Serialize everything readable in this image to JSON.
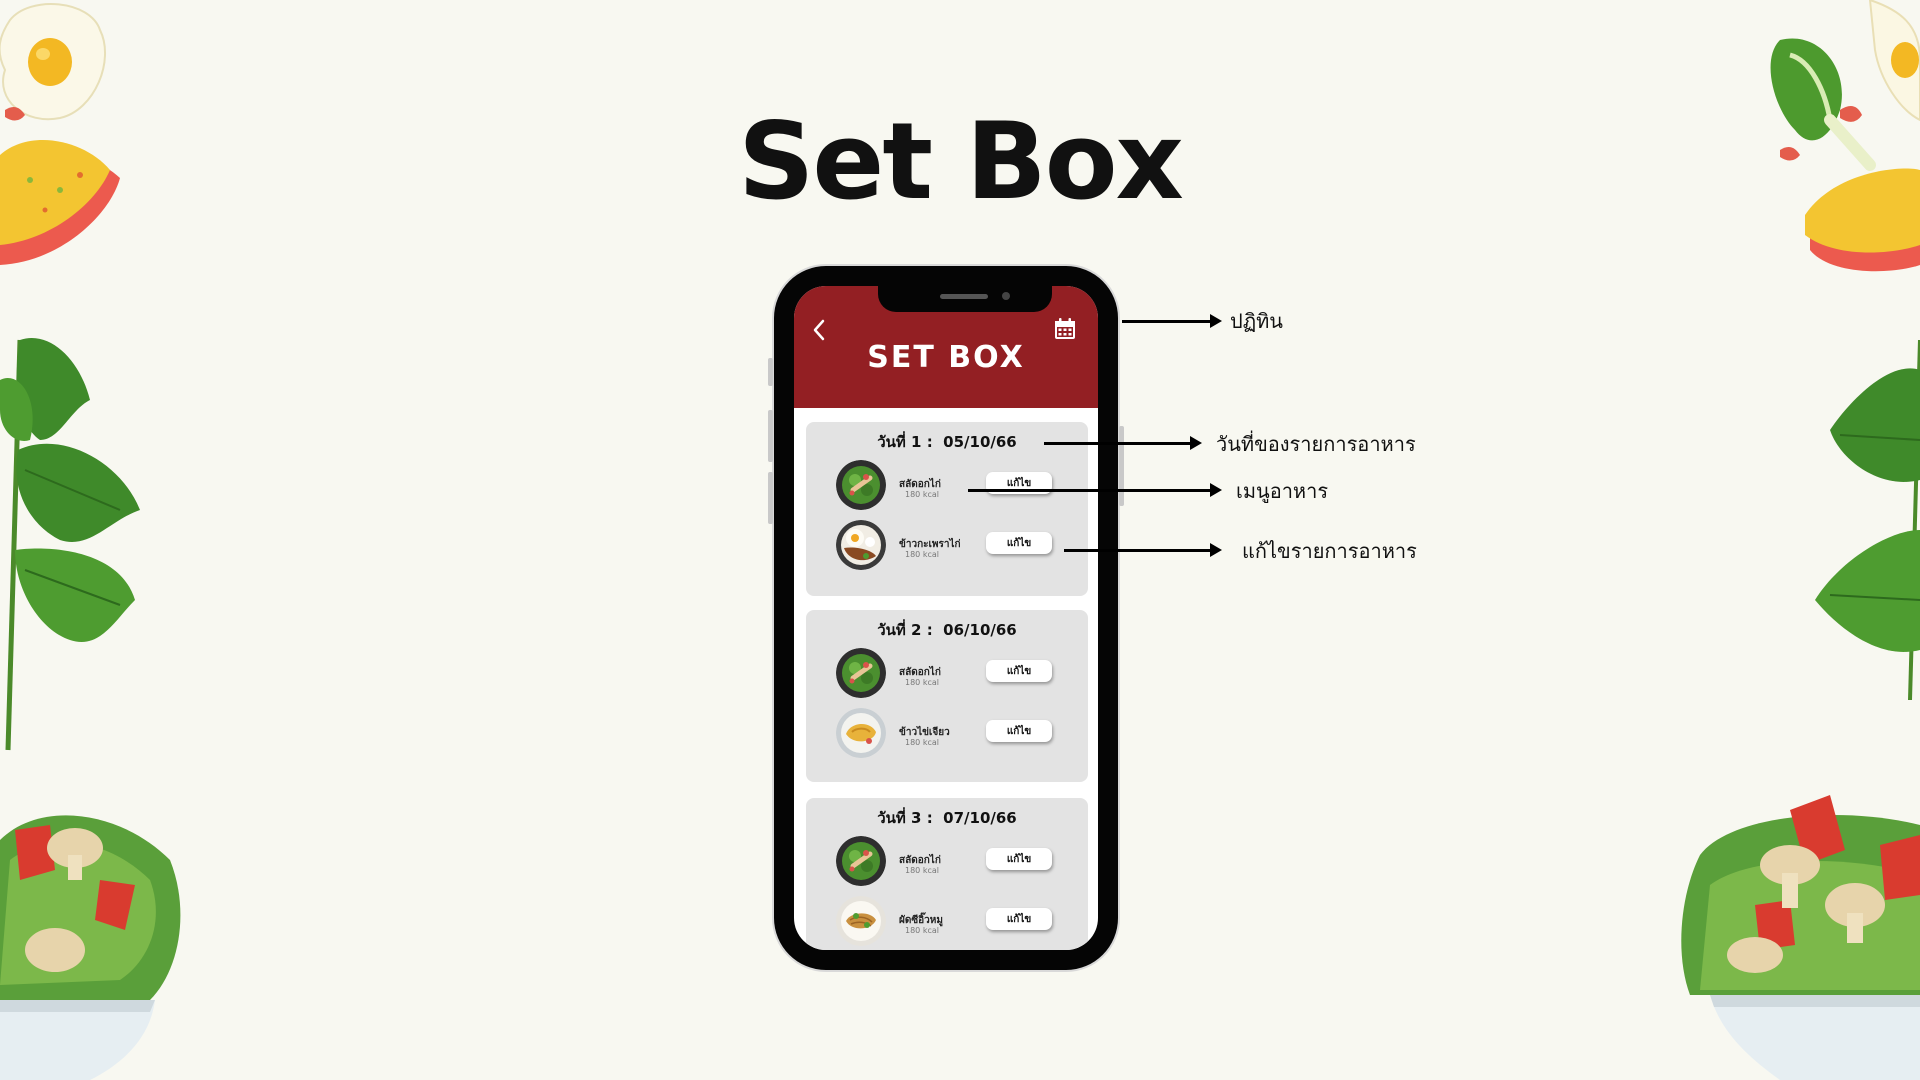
{
  "page": {
    "title": "Set Box"
  },
  "app": {
    "header_title": "SET BOX",
    "back_icon": "chevron-left-icon",
    "calendar_icon": "calendar-icon",
    "header_color": "#931f23"
  },
  "days": [
    {
      "label": "วันที่ 1 :",
      "date": "05/10/66",
      "meals": [
        {
          "name": "สลัดอกไก่",
          "kcal": "180 kcal",
          "edit_label": "แก้ไข",
          "photo": "salad"
        },
        {
          "name": "ข้าวกะเพราไก่",
          "kcal": "180 kcal",
          "edit_label": "แก้ไข",
          "photo": "rice-basil-egg"
        }
      ]
    },
    {
      "label": "วันที่ 2 :",
      "date": "06/10/66",
      "meals": [
        {
          "name": "สลัดอกไก่",
          "kcal": "180 kcal",
          "edit_label": "แก้ไข",
          "photo": "salad"
        },
        {
          "name": "ข้าวไข่เจียว",
          "kcal": "180 kcal",
          "edit_label": "แก้ไข",
          "photo": "omelet-rice"
        }
      ]
    },
    {
      "label": "วันที่ 3 :",
      "date": "07/10/66",
      "meals": [
        {
          "name": "สลัดอกไก่",
          "kcal": "180 kcal",
          "edit_label": "แก้ไข",
          "photo": "salad"
        },
        {
          "name": "ผัดซีอิ๊วหมู",
          "kcal": "180 kcal",
          "edit_label": "แก้ไข",
          "photo": "stir-fried-noodle"
        }
      ]
    }
  ],
  "annotations": [
    {
      "text": "ปฏิทิน"
    },
    {
      "text": "วันที่ของรายการอาหาร"
    },
    {
      "text": "เมนูอาหาร"
    },
    {
      "text": "แก้ไขรายการอาหาร"
    }
  ]
}
